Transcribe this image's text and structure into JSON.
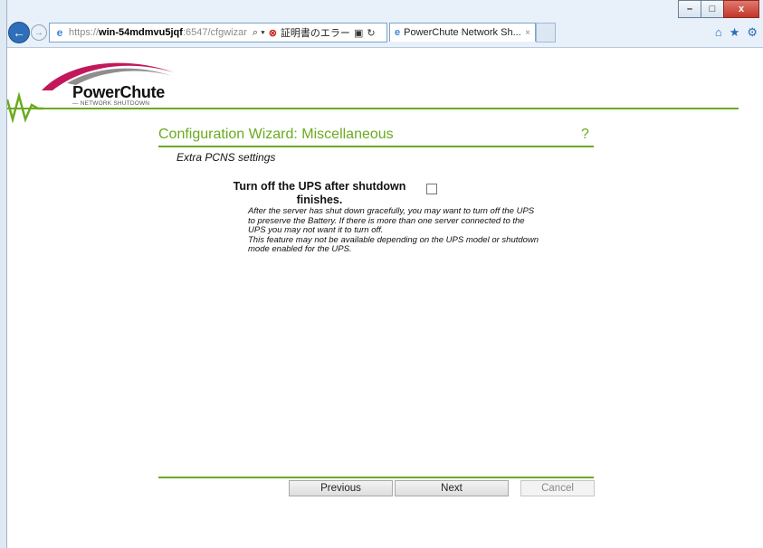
{
  "window": {
    "minimize_label": "–",
    "restore_label": "□",
    "close_label": "x"
  },
  "address_bar": {
    "url_prefix": "https://",
    "url_host": "win-54mdmvu5jqf",
    "url_rest": ":6547/cfgwizar",
    "search_glyph": "⌕ ▾",
    "cert_error_icon": "⊗",
    "cert_error_text": "証明書のエラー",
    "refresh_glyph": "↻"
  },
  "tab": {
    "title": "PowerChute Network Sh...",
    "close": "×"
  },
  "toolbar_icons": [
    "home-icon",
    "favorites-icon",
    "settings-icon"
  ],
  "logo": {
    "name": "PowerChute",
    "tagline": "— NETWORK SHUTDOWN"
  },
  "page": {
    "title": "Configuration Wizard: Miscellaneous",
    "help": "?",
    "subtitle": "Extra PCNS settings"
  },
  "option": {
    "label_line1": "Turn off the UPS after shutdown",
    "label_line2": "finishes.",
    "checked": false,
    "description": [
      "After the server has shut down gracefully, you may want to turn off the UPS",
      "to preserve the Battery. If there is more than one server connected to the",
      "UPS you may not want it to turn off.",
      "This feature may not be available depending on the UPS model or shutdown",
      "mode enabled for the UPS."
    ]
  },
  "buttons": {
    "previous": "Previous",
    "next": "Next",
    "cancel": "Cancel"
  },
  "colors": {
    "accent_green": "#6aab1f",
    "ie_blue": "#2f6fb9",
    "cert_red": "#c8261c"
  }
}
